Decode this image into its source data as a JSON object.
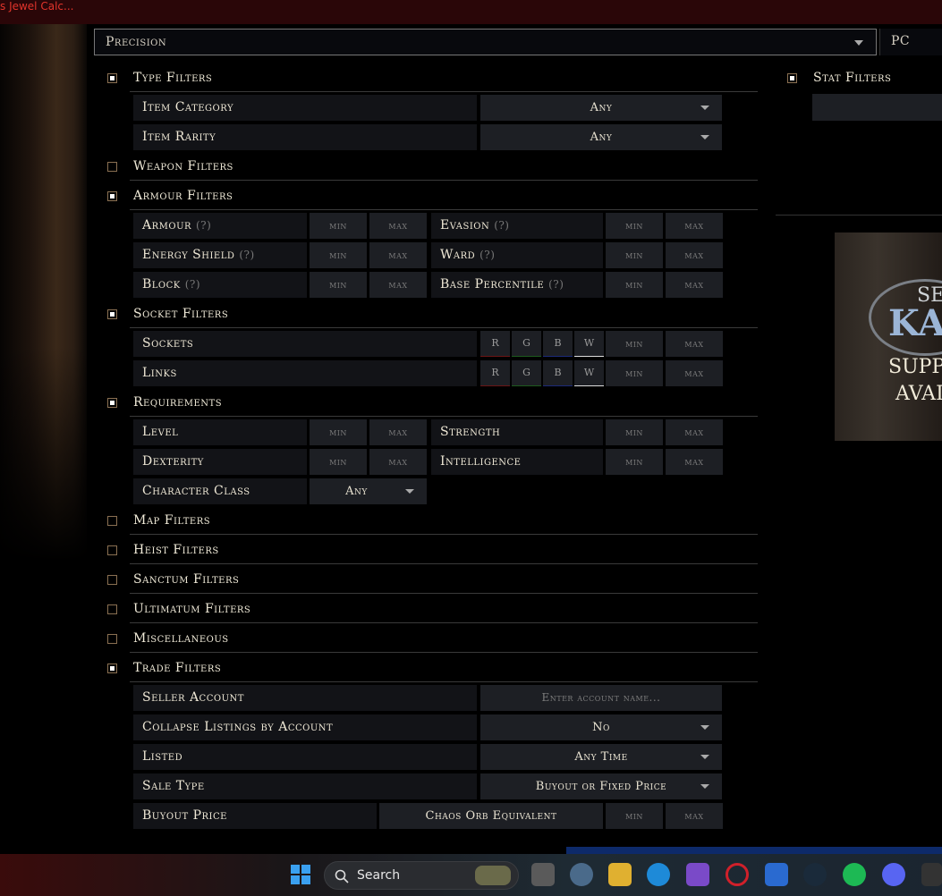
{
  "window": {
    "title": "s Jewel Calc..."
  },
  "header": {
    "league": "Precision",
    "platform": "PC"
  },
  "type_filters": {
    "label": "Type Filters",
    "item_category": {
      "label": "Item Category",
      "value": "Any"
    },
    "item_rarity": {
      "label": "Item Rarity",
      "value": "Any"
    }
  },
  "weapon_filters": {
    "label": "Weapon Filters"
  },
  "armour_filters": {
    "label": "Armour Filters",
    "armour": "Armour",
    "evasion": "Evasion",
    "energy_shield": "Energy Shield",
    "ward": "Ward",
    "block": "Block",
    "base_percentile": "Base Percentile",
    "help": "(?)"
  },
  "socket_filters": {
    "label": "Socket Filters",
    "sockets": "Sockets",
    "links": "Links",
    "colors": [
      "R",
      "G",
      "B",
      "W"
    ]
  },
  "requirements": {
    "label": "Requirements",
    "level": "Level",
    "strength": "Strength",
    "dexterity": "Dexterity",
    "intelligence": "Intelligence",
    "character_class": {
      "label": "Character Class",
      "value": "Any"
    }
  },
  "min_placeholder": "min",
  "max_placeholder": "max",
  "collapsed_sections": [
    "Map Filters",
    "Heist Filters",
    "Sanctum Filters",
    "Ultimatum Filters",
    "Miscellaneous"
  ],
  "trade_filters": {
    "label": "Trade Filters",
    "seller_account": {
      "label": "Seller Account",
      "placeholder": "Enter account name..."
    },
    "collapse_listings": {
      "label": "Collapse Listings by Account",
      "value": "No"
    },
    "listed": {
      "label": "Listed",
      "value": "Any Time"
    },
    "sale_type": {
      "label": "Sale Type",
      "value": "Buyout or Fixed Price"
    },
    "buyout_price": {
      "label": "Buyout Price",
      "currency": "Chaos Orb Equivalent"
    }
  },
  "stat_filters": {
    "label": "Stat Filters"
  },
  "ad": {
    "line1": "SE",
    "line2": "KA",
    "line3": "SUPP",
    "line4": "AVAI"
  },
  "taskbar": {
    "search_label": "Search"
  }
}
